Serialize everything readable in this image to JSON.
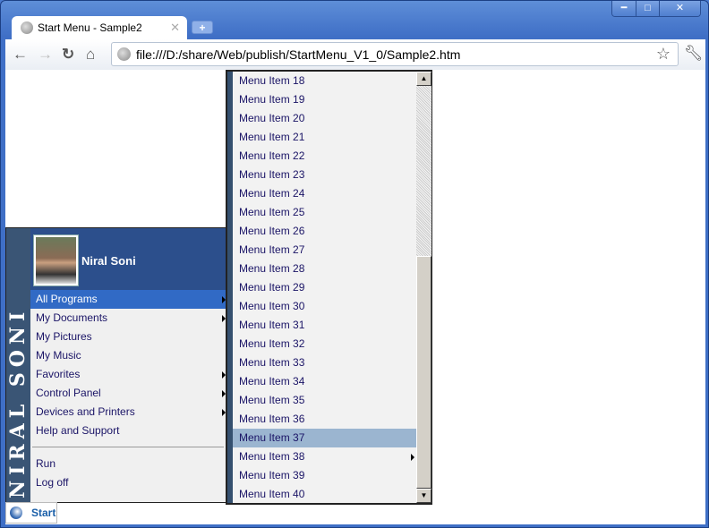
{
  "browser": {
    "tab_title": "Start Menu - Sample2",
    "url": "file:///D:/share/Web/publish/StartMenu_V1_0/Sample2.htm",
    "window_buttons": [
      "minimize",
      "maximize",
      "close"
    ]
  },
  "start_menu": {
    "banner_text": "NIRAL SONI",
    "user_name": "Niral Soni",
    "items": [
      {
        "label": "All Programs",
        "submenu": true,
        "highlighted": true
      },
      {
        "label": "My Documents",
        "submenu": true
      },
      {
        "label": "My Pictures",
        "submenu": false
      },
      {
        "label": "My Music",
        "submenu": false
      },
      {
        "label": "Favorites",
        "submenu": true
      },
      {
        "label": "Control Panel",
        "submenu": true
      },
      {
        "label": "Devices and Printers",
        "submenu": true
      },
      {
        "label": "Help and Support",
        "submenu": false
      }
    ],
    "bottom_items": [
      {
        "label": "Run"
      },
      {
        "label": "Log off"
      }
    ],
    "start_label": "Start"
  },
  "submenu": {
    "items": [
      "Menu Item 18",
      "Menu Item 19",
      "Menu Item 20",
      "Menu Item 21",
      "Menu Item 22",
      "Menu Item 23",
      "Menu Item 24",
      "Menu Item 25",
      "Menu Item 26",
      "Menu Item 27",
      "Menu Item 28",
      "Menu Item 29",
      "Menu Item 30",
      "Menu Item 31",
      "Menu Item 32",
      "Menu Item 33",
      "Menu Item 34",
      "Menu Item 35",
      "Menu Item 36",
      "Menu Item 37",
      "Menu Item 38",
      "Menu Item 39",
      "Menu Item 40"
    ],
    "highlighted": "Menu Item 37",
    "with_submenu": "Menu Item 38",
    "scroll_position_percent": 100
  },
  "colors": {
    "header": "#2c4f8c",
    "highlight": "#316ac5",
    "sub_highlight": "#9bb5d0",
    "banner": "#3a5575"
  }
}
